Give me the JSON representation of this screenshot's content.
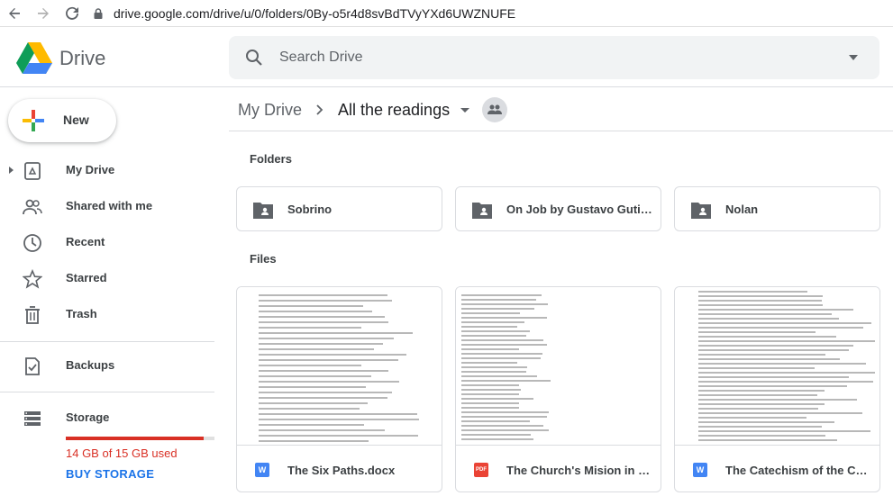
{
  "browser": {
    "url": "drive.google.com/drive/u/0/folders/0By-o5r4d8svBdTVyYXd6UWZNUFE"
  },
  "header": {
    "app_name": "Drive",
    "search_placeholder": "Search Drive"
  },
  "sidebar": {
    "new_label": "New",
    "items": [
      {
        "label": "My Drive",
        "icon": "my-drive-icon"
      },
      {
        "label": "Shared with me",
        "icon": "shared-icon"
      },
      {
        "label": "Recent",
        "icon": "clock-icon"
      },
      {
        "label": "Starred",
        "icon": "star-icon"
      },
      {
        "label": "Trash",
        "icon": "trash-icon"
      },
      {
        "label": "Backups",
        "icon": "backups-icon"
      },
      {
        "label": "Storage",
        "icon": "storage-icon"
      }
    ],
    "storage": {
      "used_text": "14 GB of 15 GB used",
      "fraction_used": 0.93,
      "buy_label": "BUY STORAGE"
    }
  },
  "breadcrumb": {
    "root": "My Drive",
    "current": "All the readings"
  },
  "sections": {
    "folders_title": "Folders",
    "files_title": "Files"
  },
  "folders": [
    {
      "name": "Sobrino"
    },
    {
      "name": "On Job by Gustavo Gutierrez"
    },
    {
      "name": "Nolan"
    }
  ],
  "files": [
    {
      "name": "The Six Paths.docx",
      "type_label": "W",
      "type_color": "#4285f4"
    },
    {
      "name": "The Church's Mision in the World.pdf",
      "type_label": "PDF",
      "type_color": "#ea4335"
    },
    {
      "name": "The Catechism of the Catholic Church",
      "type_label": "W",
      "type_color": "#4285f4"
    }
  ],
  "colors": {
    "accent": "#1a73e8",
    "warning": "#d93025"
  }
}
